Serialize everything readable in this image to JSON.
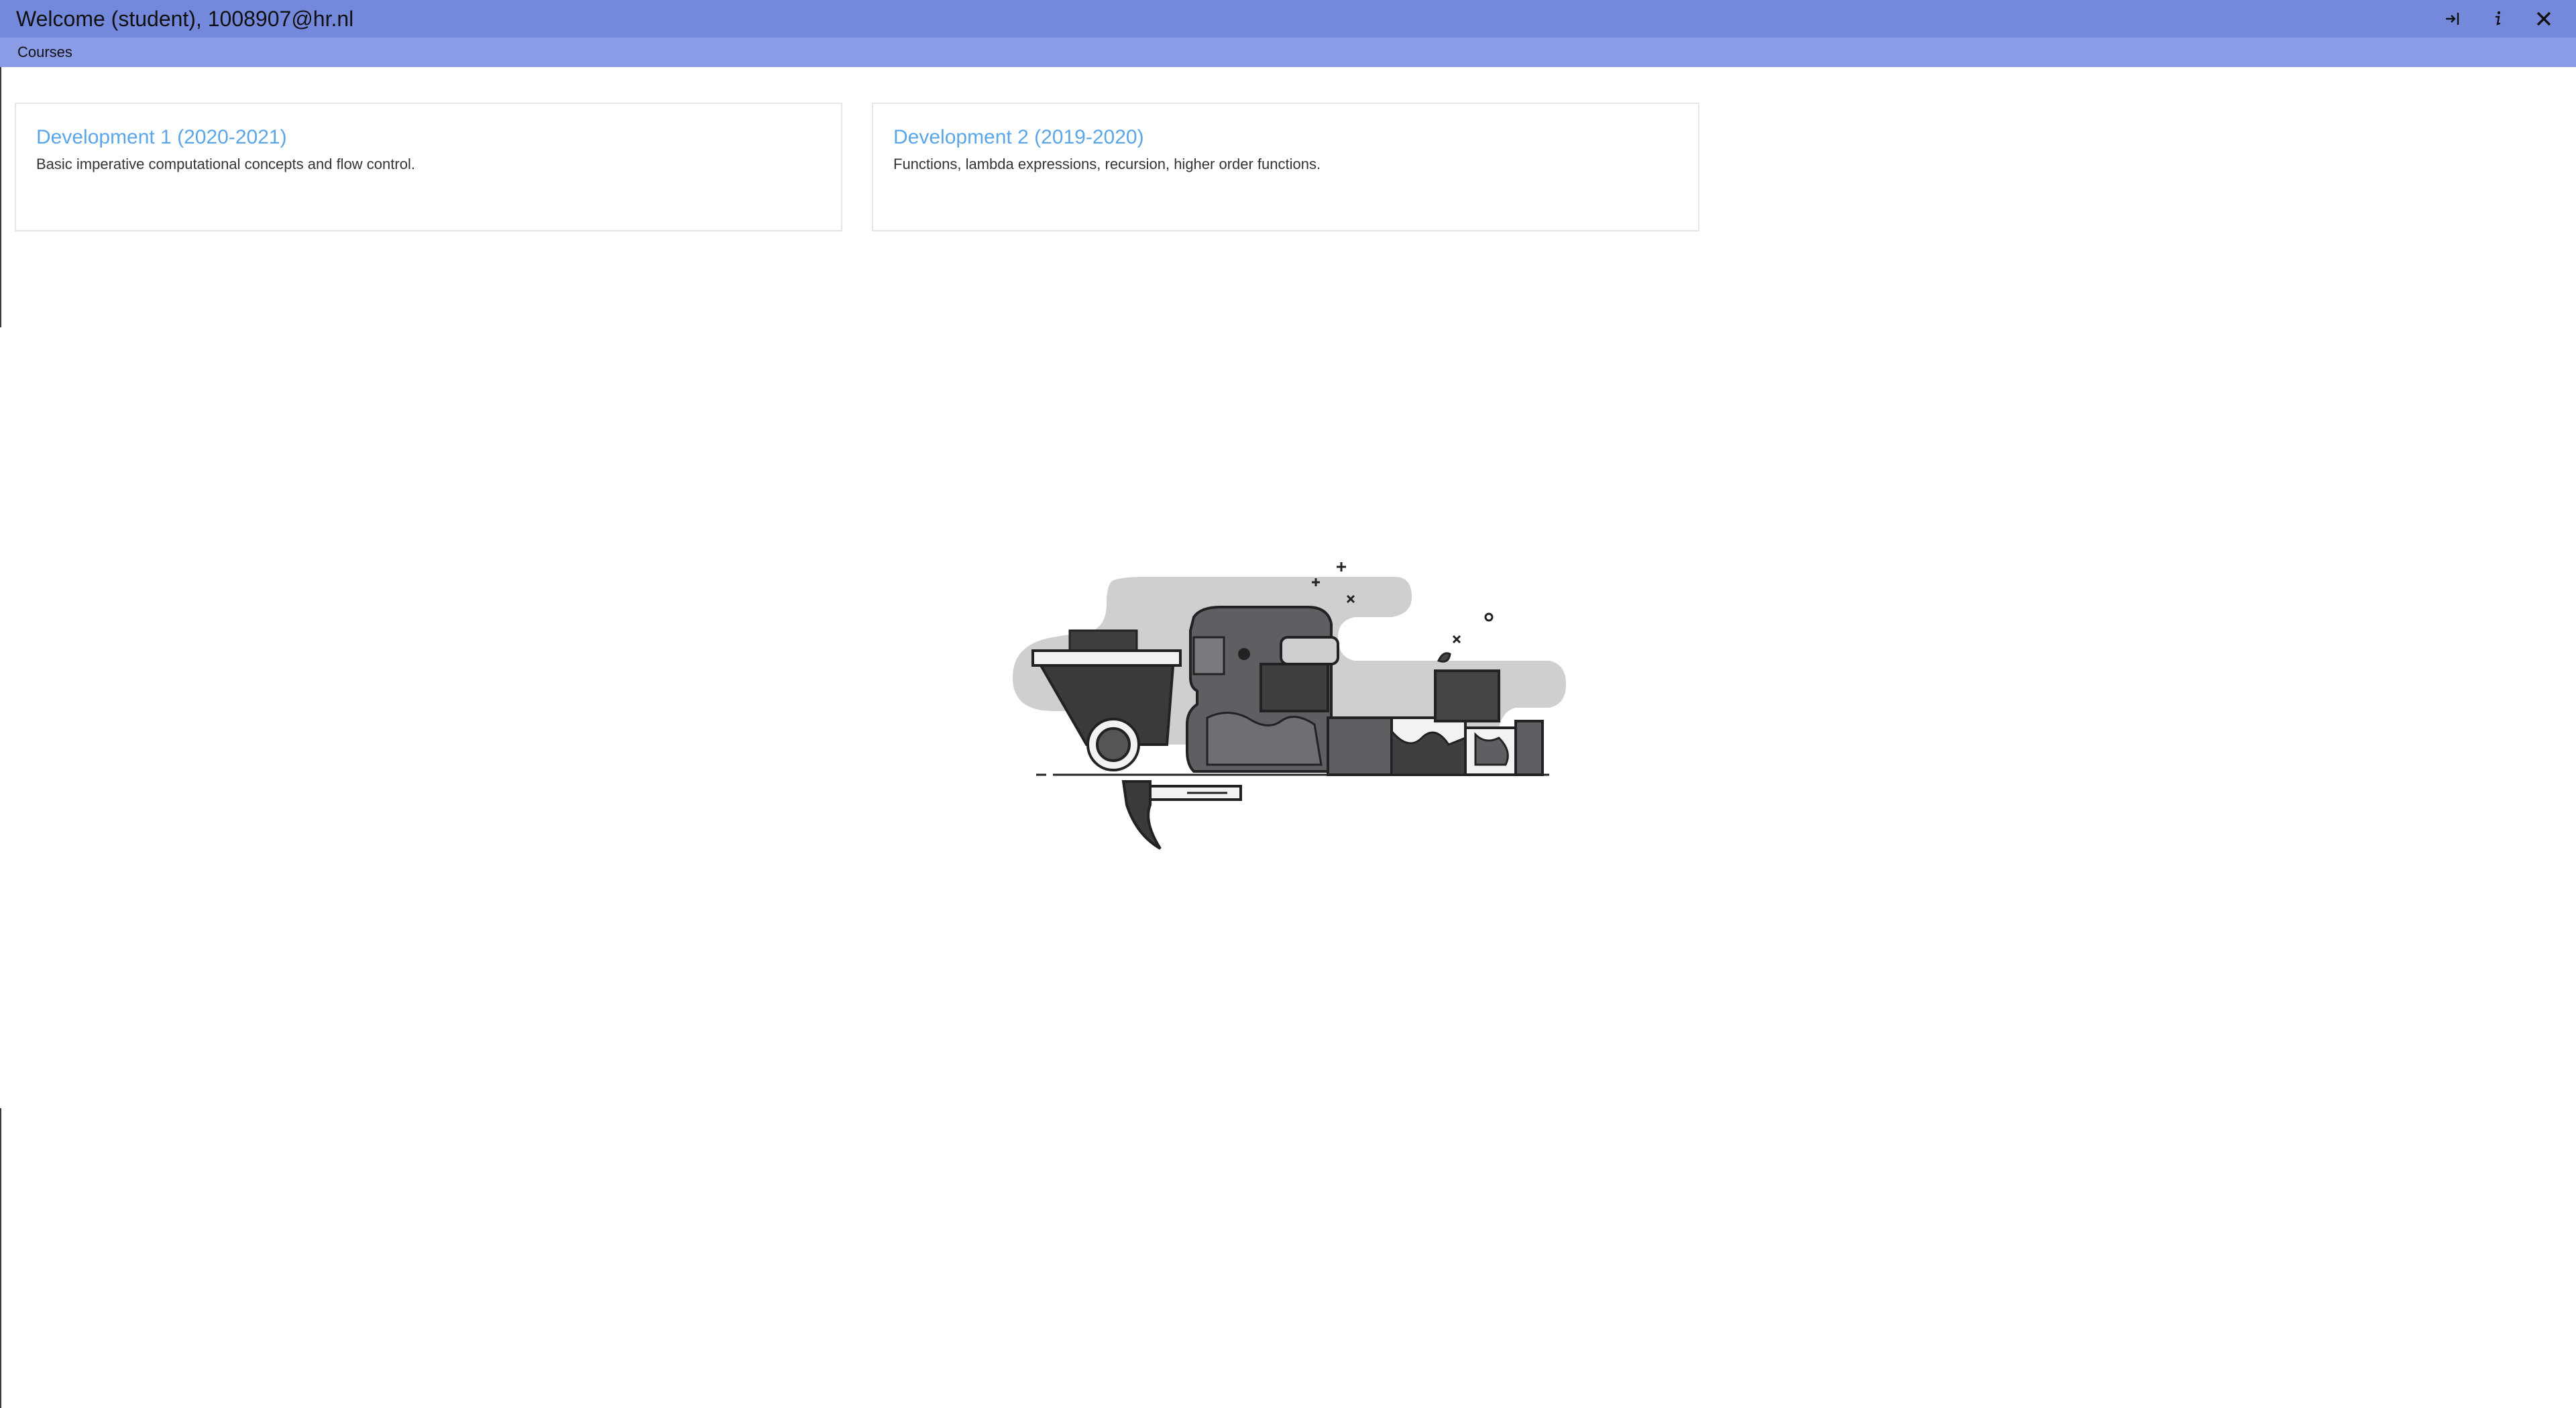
{
  "window": {
    "title": "Welcome (student), 1008907@hr.nl",
    "actions": [
      {
        "icon": "logout-icon"
      },
      {
        "icon": "info-icon"
      },
      {
        "icon": "close-icon"
      }
    ]
  },
  "menu": {
    "courses_label": "Courses"
  },
  "courses": [
    {
      "title": "Development 1 (2020-2021)",
      "description": "Basic imperative computational concepts and flow control."
    },
    {
      "title": "Development 2 (2019-2020)",
      "description": "Functions, lambda expressions, recursion, higher order functions."
    }
  ],
  "colors": {
    "titlebar": "#7589dc",
    "menubar": "#8b9ce6",
    "link": "#5aa6e8"
  }
}
